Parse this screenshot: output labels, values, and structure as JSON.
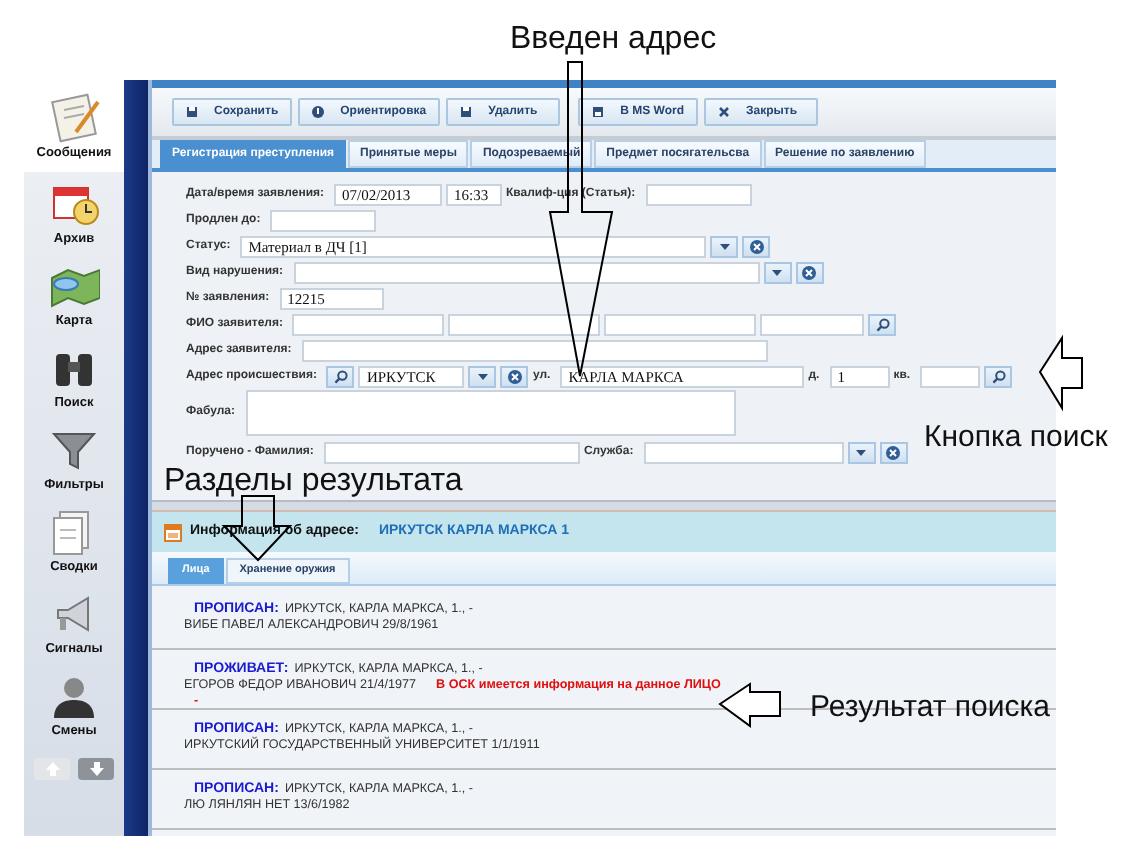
{
  "annotations": [
    {
      "text": "Введен адрес"
    },
    {
      "text": "Кнопка поиск"
    },
    {
      "text": "Разделы результата"
    },
    {
      "text": "Результат поиска"
    }
  ],
  "sidebar": {
    "items": [
      {
        "label": "Сообщения",
        "selected": true
      },
      {
        "label": "Архив",
        "selected": false
      },
      {
        "label": "Карта",
        "selected": false
      },
      {
        "label": "Поиск",
        "selected": false
      },
      {
        "label": "Фильтры",
        "selected": false
      },
      {
        "label": "Сводки",
        "selected": false
      },
      {
        "label": "Сигналы",
        "selected": false
      },
      {
        "label": "Смены",
        "selected": false
      }
    ]
  },
  "toolbar": {
    "buttons": [
      "Сохранить",
      "Ориентировка",
      "Удалить",
      "В MS Word",
      "Закрыть"
    ]
  },
  "tabs": [
    {
      "label": "Регистрация преступления",
      "selected": true
    },
    {
      "label": "Принятые меры",
      "selected": false
    },
    {
      "label": "Подозреваемый",
      "selected": false
    },
    {
      "label": "Предмет посягательсва",
      "selected": false
    },
    {
      "label": "Решение по заявлению",
      "selected": false
    }
  ],
  "form": {
    "rows": [
      {
        "label": "Дата/время заявления:",
        "fields": [
          {
            "kind": "input",
            "value": "07/02/2013"
          },
          {
            "kind": "input",
            "value": "16:33"
          },
          {
            "kind": "label",
            "value": "Квалиф-ция (Статья):"
          },
          {
            "kind": "input"
          }
        ]
      },
      {
        "label": "Продлен до:",
        "fields": [
          {
            "kind": "input"
          }
        ]
      },
      {
        "label": "Статус:",
        "fields": [
          {
            "kind": "select",
            "value": "Материал в ДЧ [1]"
          },
          {
            "kind": "dropdown"
          },
          {
            "kind": "clear"
          }
        ]
      },
      {
        "label": "Вид нарушения:",
        "fields": [
          {
            "kind": "select"
          },
          {
            "kind": "dropdown"
          },
          {
            "kind": "clear"
          }
        ]
      },
      {
        "label": "№ заявления:",
        "fields": [
          {
            "kind": "input",
            "value": "12215"
          }
        ]
      },
      {
        "label": "ФИО заявителя:",
        "fields": [
          {
            "kind": "input"
          },
          {
            "kind": "input"
          },
          {
            "kind": "input"
          },
          {
            "kind": "input"
          },
          {
            "kind": "search"
          }
        ]
      },
      {
        "label": "Адрес заявителя:",
        "fields": [
          {
            "kind": "input"
          }
        ]
      },
      {
        "label": "Адрес происшествия:",
        "fields": [
          {
            "kind": "search"
          },
          {
            "kind": "input",
            "value": "ИРКУТСК"
          },
          {
            "kind": "dropdown"
          },
          {
            "kind": "clear"
          },
          {
            "kind": "label",
            "value": "ул."
          },
          {
            "kind": "input",
            "value": "КАРЛА МАРКСА"
          },
          {
            "kind": "label",
            "value": "д."
          },
          {
            "kind": "input",
            "value": "1"
          },
          {
            "kind": "label",
            "value": "кв."
          },
          {
            "kind": "input"
          },
          {
            "kind": "search"
          }
        ]
      },
      {
        "label": "Фабула:",
        "fields": [
          {
            "kind": "textarea"
          }
        ]
      },
      {
        "label": "Поручено - Фамилия:",
        "fields": [
          {
            "kind": "input"
          },
          {
            "kind": "label",
            "value": "Служба:"
          },
          {
            "kind": "input"
          },
          {
            "kind": "dropdown"
          },
          {
            "kind": "clear"
          }
        ]
      }
    ]
  },
  "address_info": {
    "label": "Информация об адресе:",
    "value": "ИРКУТСК КАРЛА МАРКСА 1"
  },
  "result_tabs": [
    {
      "label": "Лица",
      "selected": true
    },
    {
      "label": "Хранение оружия",
      "selected": false
    }
  ],
  "results": [
    {
      "status": "ПРОПИСАН:",
      "address": "ИРКУТСК, КАРЛА МАРКСА, 1., -",
      "person": "ВИБЕ ПАВЕЛ АЛЕКСАНДРОВИЧ 29/8/1961"
    },
    {
      "status": "ПРОЖИВАЕТ:",
      "address": "ИРКУТСК, КАРЛА МАРКСА, 1., -",
      "person": "ЕГОРОВ ФЕДОР ИВАНОВИЧ 21/4/1977",
      "note": "В ОСК имеется информация на данное ЛИЦО",
      "note_2": "-"
    },
    {
      "status": "ПРОПИСАН:",
      "address": "ИРКУТСК, КАРЛА МАРКСА, 1., -",
      "person": "ИРКУТСКИЙ ГОСУДАРСТВЕННЫЙ УНИВЕРСИТЕТ 1/1/1911"
    },
    {
      "status": "ПРОПИСАН:",
      "address": "ИРКУТСК, КАРЛА МАРКСА, 1., -",
      "person": "ЛЮ ЛЯНЛЯН НЕТ 13/6/1982"
    }
  ]
}
